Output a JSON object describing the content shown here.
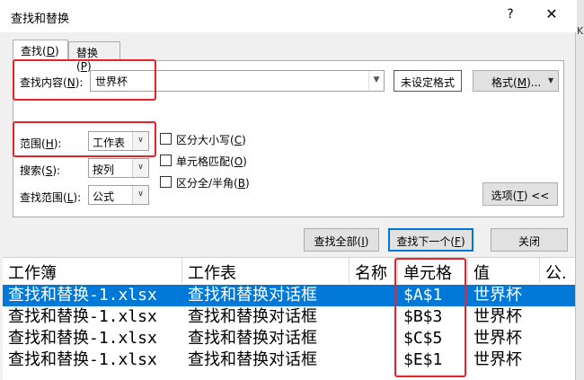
{
  "window": {
    "title": "查找和替换",
    "help": "?",
    "close": "✕",
    "behind_letter": "K"
  },
  "tabs": [
    {
      "label": "查找",
      "key": "D"
    },
    {
      "label": "替换",
      "key": "P"
    }
  ],
  "find": {
    "label": "查找内容",
    "key": "N",
    "value": "世界杯"
  },
  "format_preview": "未设定格式",
  "format_button": {
    "label": "格式",
    "key": "M",
    "suffix": "..."
  },
  "options": {
    "within": {
      "label": "范围",
      "key": "H",
      "value": "工作表"
    },
    "search": {
      "label": "搜索",
      "key": "S",
      "value": "按列"
    },
    "look_in": {
      "label": "查找范围",
      "key": "L",
      "value": "公式"
    },
    "match_case": {
      "label": "区分大小写",
      "key": "C",
      "checked": false
    },
    "match_entire": {
      "label": "单元格匹配",
      "key": "O",
      "checked": false
    },
    "match_byte": {
      "label": "区分全/半角",
      "key": "B",
      "checked": false
    }
  },
  "options_button": {
    "label": "选项",
    "key": "T",
    "suffix": " <<"
  },
  "buttons": {
    "find_all": {
      "label": "查找全部",
      "key": "I"
    },
    "find_next": {
      "label": "查找下一个",
      "key": "F"
    },
    "close": {
      "label": "关闭"
    }
  },
  "results": {
    "columns": [
      "工作簿",
      "工作表",
      "名称",
      "单元格",
      "值",
      "公."
    ],
    "rows": [
      {
        "workbook": "查找和替换-1.xlsx",
        "sheet": "查找和替换对话框",
        "name": "",
        "cell": "$A$1",
        "value": "世界杯"
      },
      {
        "workbook": "查找和替换-1.xlsx",
        "sheet": "查找和替换对话框",
        "name": "",
        "cell": "$B$3",
        "value": "世界杯"
      },
      {
        "workbook": "查找和替换-1.xlsx",
        "sheet": "查找和替换对话框",
        "name": "",
        "cell": "$C$5",
        "value": "世界杯"
      },
      {
        "workbook": "查找和替换-1.xlsx",
        "sheet": "查找和替换对话框",
        "name": "",
        "cell": "$E$1",
        "value": "世界杯"
      }
    ]
  },
  "colors": {
    "highlight": "#e8212a",
    "selection": "#0078d7"
  }
}
